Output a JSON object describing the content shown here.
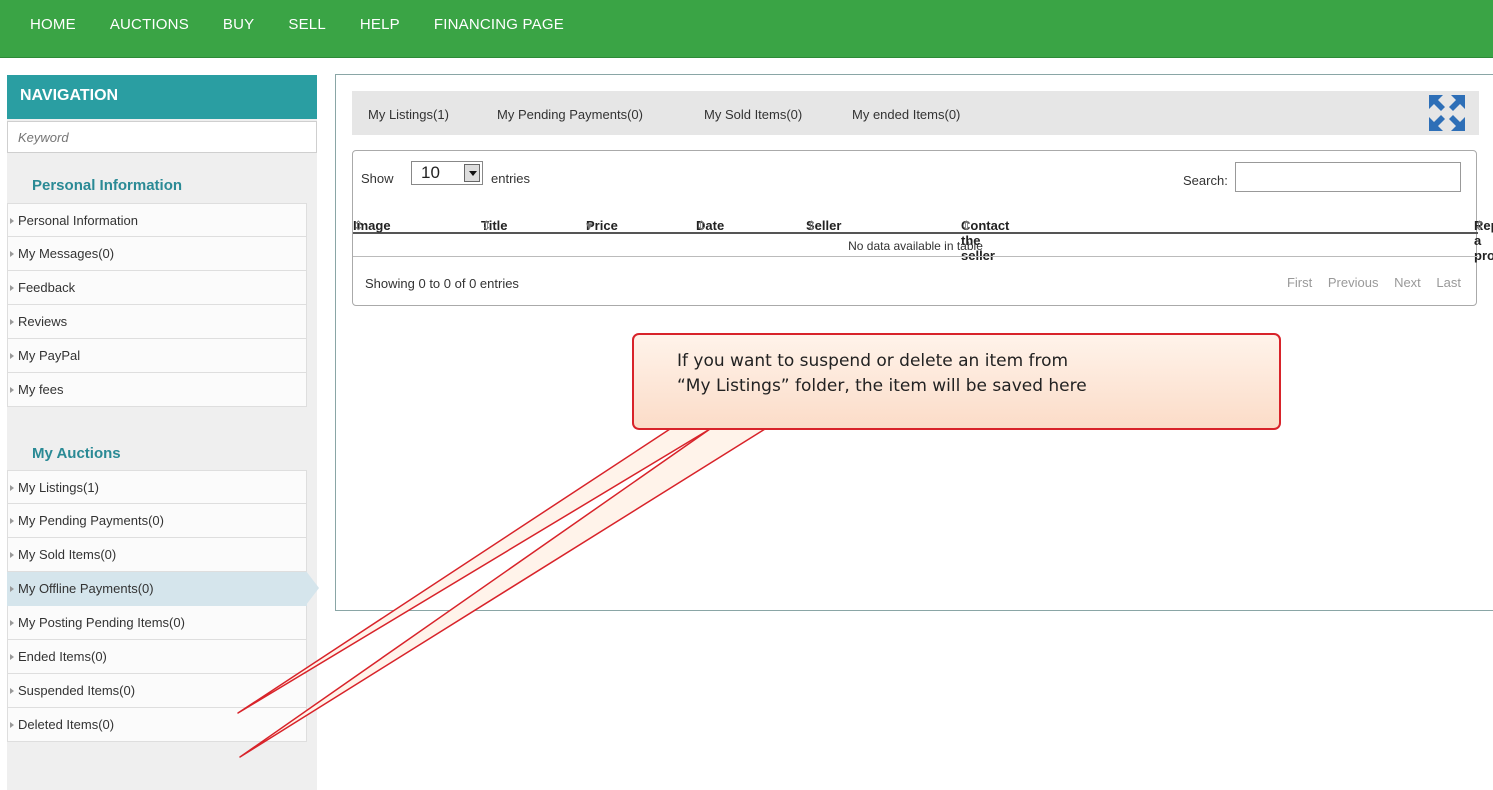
{
  "topnav": {
    "items": [
      "HOME",
      "AUCTIONS",
      "BUY",
      "SELL",
      "HELP",
      "FINANCING PAGE"
    ]
  },
  "sidebar": {
    "header": "NAVIGATION",
    "keyword_placeholder": "Keyword",
    "personal": {
      "title": "Personal Information",
      "items": [
        "Personal Information",
        "My Messages(0)",
        "Feedback",
        "Reviews",
        "My PayPal",
        "My fees"
      ]
    },
    "auctions": {
      "title": "My Auctions",
      "items": [
        "My Listings(1)",
        "My Pending Payments(0)",
        "My Sold Items(0)",
        "My Offline Payments(0)",
        "My Posting Pending Items(0)",
        "Ended Items(0)",
        "Suspended Items(0)",
        "Deleted Items(0)"
      ],
      "active": "My Offline Payments(0)"
    }
  },
  "tabs": [
    "My Listings(1)",
    "My Pending Payments(0)",
    "My Sold Items(0)",
    "My ended Items(0)"
  ],
  "table": {
    "show_label": "Show",
    "page_size": "10",
    "entries_label": "entries",
    "search_label": "Search:",
    "search_value": "",
    "columns": [
      "Image",
      "Title",
      "Price",
      "Date",
      "Seller",
      "Contact the seller",
      "Report a problem"
    ],
    "empty_text": "No data available in table",
    "info": "Showing 0 to 0 of 0 entries",
    "pager": [
      "First",
      "Previous",
      "Next",
      "Last"
    ]
  },
  "callout": {
    "line1": "If you want to suspend or delete an item from",
    "line2": "“My Listings” folder, the item will be saved here"
  },
  "colors": {
    "topnav": "#3aa445",
    "nav_header": "#2a9ea2",
    "section_title": "#2a8a95",
    "callout_border": "#d8232a",
    "expand_icon": "#2e6fb7"
  }
}
